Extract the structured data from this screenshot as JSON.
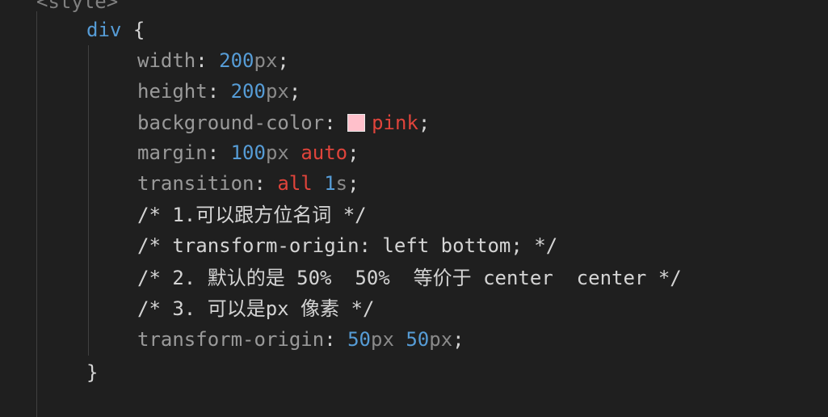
{
  "code": {
    "open_tag": "<style>",
    "selector": "div",
    "open_brace": "{",
    "close_brace": "}",
    "width": {
      "prop": "width",
      "value": "200",
      "unit": "px"
    },
    "height": {
      "prop": "height",
      "value": "200",
      "unit": "px"
    },
    "background": {
      "prop": "background-color",
      "value": "pink",
      "swatch_color": "#ffc0cb"
    },
    "margin": {
      "prop": "margin",
      "value": "100",
      "unit": "px",
      "keyword": "auto"
    },
    "transition": {
      "prop": "transition",
      "keyword": "all",
      "value": "1",
      "unit": "s"
    },
    "comment1": "/* 1.可以跟方位名词 */",
    "comment2": "/* transform-origin: left bottom; */",
    "comment3": "/* 2. 默认的是 50%  50%  等价于 center  center */",
    "comment4": "/* 3. 可以是px 像素 */",
    "origin": {
      "prop": "transform-origin",
      "value1": "50",
      "unit1": "px",
      "value2": "50",
      "unit2": "px"
    },
    "colon": ": ",
    "semicolon": ";"
  }
}
